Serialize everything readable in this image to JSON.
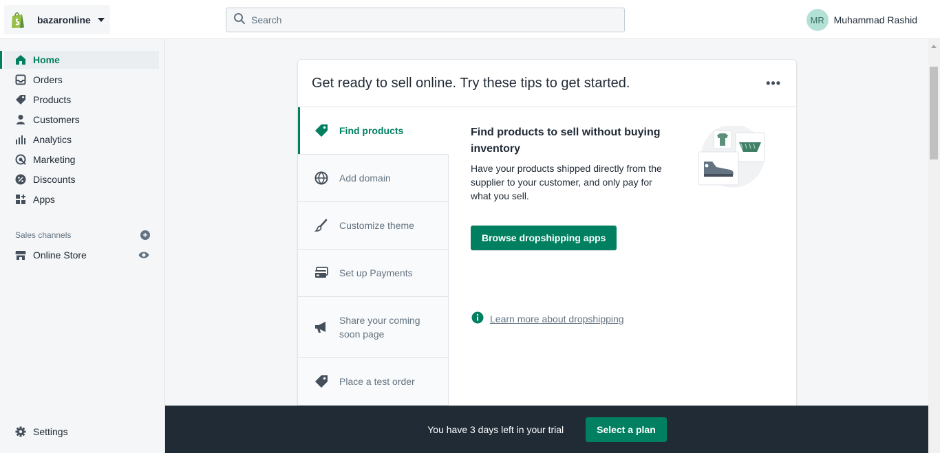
{
  "store": {
    "name": "bazaronline",
    "logo_icon": "shopify-bag-icon"
  },
  "search": {
    "placeholder": "Search"
  },
  "user": {
    "initials": "MR",
    "name": "Muhammad Rashid"
  },
  "sidebar": {
    "items": [
      {
        "label": "Home",
        "icon": "home-icon",
        "active": true
      },
      {
        "label": "Orders",
        "icon": "inbox-icon"
      },
      {
        "label": "Products",
        "icon": "tag-icon"
      },
      {
        "label": "Customers",
        "icon": "person-icon"
      },
      {
        "label": "Analytics",
        "icon": "bar-chart-icon"
      },
      {
        "label": "Marketing",
        "icon": "target-icon"
      },
      {
        "label": "Discounts",
        "icon": "discount-icon"
      },
      {
        "label": "Apps",
        "icon": "apps-icon"
      }
    ],
    "sales_channels_label": "Sales channels",
    "online_store_label": "Online Store",
    "settings_label": "Settings"
  },
  "card": {
    "title": "Get ready to sell online. Try these tips to get started.",
    "more": "•••",
    "tabs": [
      {
        "label": "Find products",
        "icon": "tag-icon",
        "active": true
      },
      {
        "label": "Add domain",
        "icon": "globe-icon"
      },
      {
        "label": "Customize theme",
        "icon": "brush-icon"
      },
      {
        "label": "Set up Payments",
        "icon": "credit-card-icon"
      },
      {
        "label": "Share your coming soon page",
        "icon": "megaphone-icon"
      },
      {
        "label": "Place a test order",
        "icon": "tag-icon"
      }
    ],
    "detail_title": "Find products to sell without buying inventory",
    "detail_body": "Have your products shipped directly from the supplier to your customer, and only pay for what you sell.",
    "primary_button": "Browse dropshipping apps",
    "learn_more": "Learn more about dropshipping"
  },
  "trial": {
    "message": "You have 3 days left in your trial",
    "button": "Select a plan"
  },
  "colors": {
    "accent": "#008060",
    "dark_bar": "#212b36",
    "sidebar_bg": "#f4f6f8"
  }
}
